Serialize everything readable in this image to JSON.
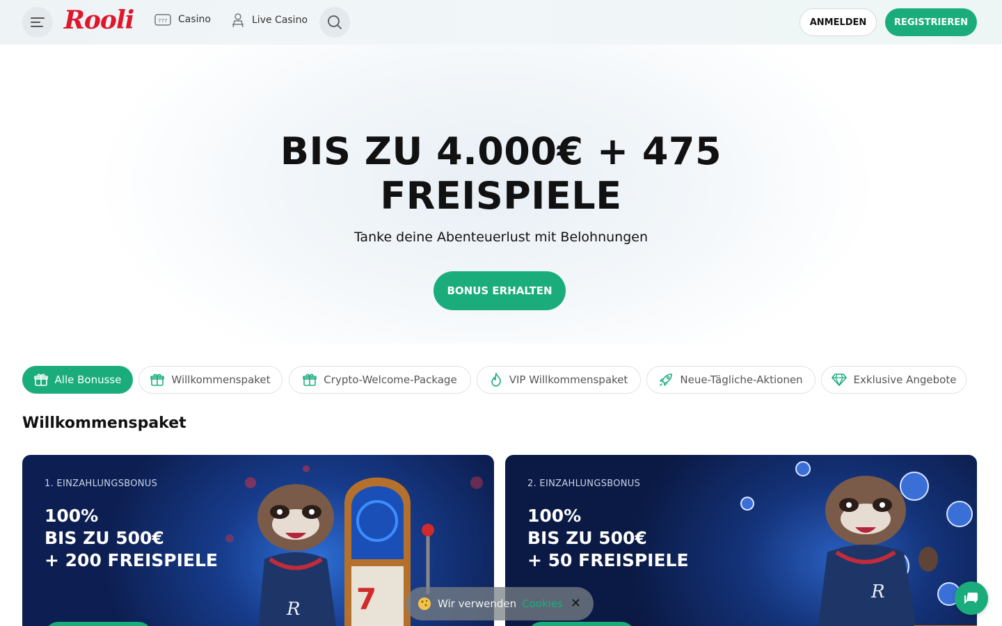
{
  "header": {
    "logo": "Rooli",
    "nav": [
      {
        "label": "Casino",
        "icon": "slot-machine-icon"
      },
      {
        "label": "Live Casino",
        "icon": "dealer-icon"
      }
    ],
    "login_label": "ANMELDEN",
    "register_label": "REGISTRIEREN"
  },
  "hero": {
    "title_line1": "BIS ZU 4.000€ + 475",
    "title_line2": "FREISPIELE",
    "subtitle": "Tanke deine Abenteuerlust mit Belohnungen",
    "cta": "BONUS ERHALTEN"
  },
  "filters": [
    {
      "label": "Alle Bonusse",
      "icon": "gift-icon",
      "active": true
    },
    {
      "label": "Willkommenspaket",
      "icon": "gift-icon",
      "active": false
    },
    {
      "label": "Crypto-Welcome-Package",
      "icon": "gift-icon",
      "active": false
    },
    {
      "label": "VIP Willkommenspaket",
      "icon": "flame-icon",
      "active": false
    },
    {
      "label": "Neue-Tägliche-Aktionen",
      "icon": "rocket-icon",
      "active": false
    },
    {
      "label": "Exklusive Angebote",
      "icon": "diamond-icon",
      "active": false
    }
  ],
  "section": {
    "title": "Willkommenspaket"
  },
  "cards": [
    {
      "label": "1. EINZAHLUNGSBONUS",
      "line1": "100%",
      "line2": "BIS ZU 500€",
      "line3": "+ 200 FREISPIELE"
    },
    {
      "label": "2. EINZAHLUNGSBONUS",
      "line1": "100%",
      "line2": "BIS ZU 500€",
      "line3": "+ 50 FREISPIELE"
    }
  ],
  "cookie": {
    "text": "Wir verwenden",
    "link": "Cookies",
    "close": "✕"
  },
  "colors": {
    "accent": "#1aad7b",
    "logo": "#e0162b"
  }
}
